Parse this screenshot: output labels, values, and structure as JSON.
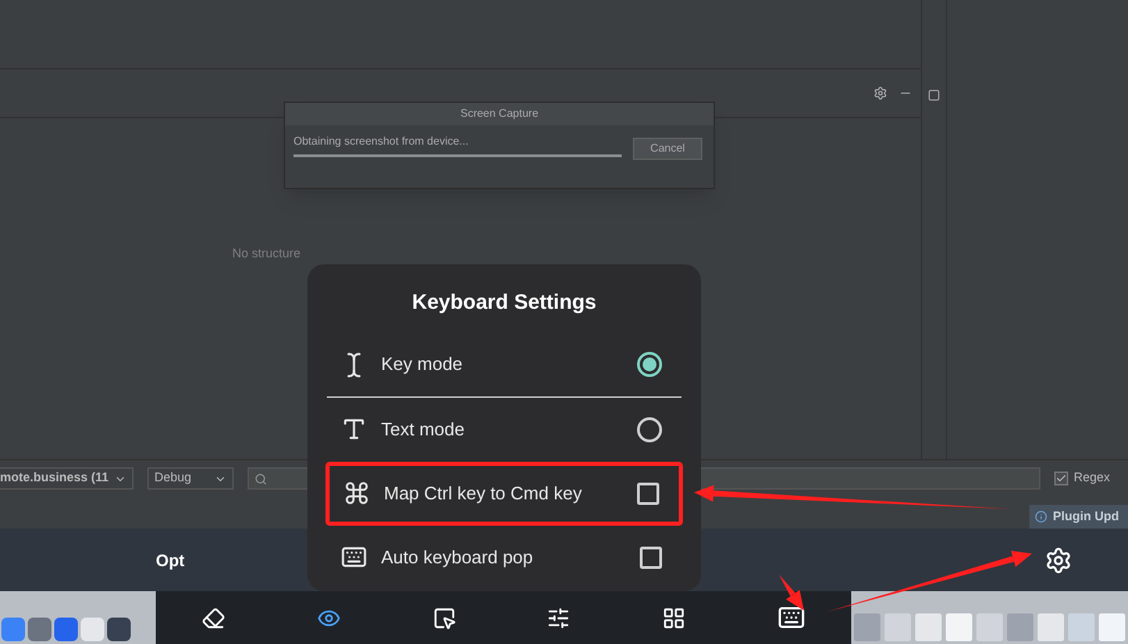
{
  "dialog": {
    "title": "Screen Capture",
    "message": "Obtaining screenshot from device...",
    "progress": {
      "level": 1
    },
    "cancel_button": "Cancel"
  },
  "structure_panel": {
    "empty_text": "No structure"
  },
  "run_toolbar": {
    "configuration": "mote.business (11",
    "build_variant": "Debug",
    "regex": {
      "label": "Regex",
      "checked": true
    }
  },
  "notification": "Plugin Upd",
  "key_bar": {
    "label": "Opt"
  },
  "keyboard_settings": {
    "title": "Keyboard Settings",
    "options": [
      {
        "kind": "radio",
        "label": "Key mode",
        "selected": true
      },
      {
        "kind": "radio",
        "label": "Text mode",
        "selected": false
      },
      {
        "kind": "checkbox",
        "label": "Map Ctrl key to Cmd key",
        "checked": false,
        "highlighted": true
      },
      {
        "kind": "checkbox",
        "label": "Auto keyboard pop",
        "checked": false,
        "highlighted": false
      }
    ]
  }
}
